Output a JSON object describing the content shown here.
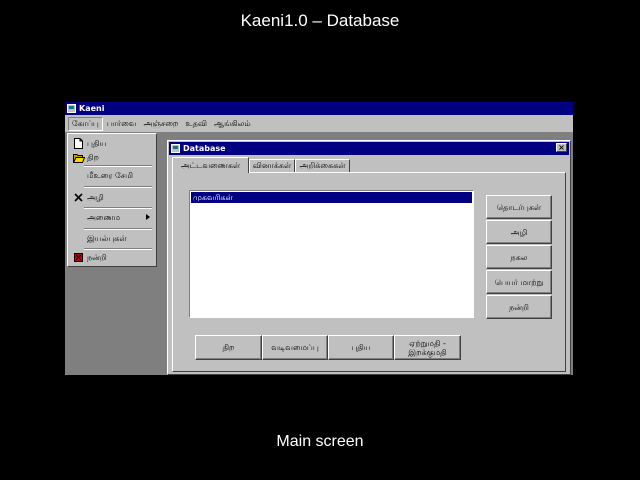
{
  "slide": {
    "title": "Kaeni1.0 – Database",
    "caption": "Main screen"
  },
  "app": {
    "title": "Kaeni",
    "menus": [
      "கோப்பு",
      "பார்வை",
      "அஞ்சறை",
      "உதவி",
      "ஆங்கிலம்"
    ],
    "file_menu": {
      "new": "புதிய",
      "open": "திற",
      "save_changes": "மீஉரை சேமி",
      "delete": "அழி",
      "page_setup": "அணைம",
      "properties": "இயல்புகள்",
      "exit": "நன்றி"
    }
  },
  "db_window": {
    "title": "Database",
    "close": "×",
    "tabs": [
      "அட்டவணைகள்",
      "வினாக்கள்",
      "அறிக்கைகள்"
    ],
    "list_items": [
      "முகவரிகள்"
    ],
    "side_buttons": [
      "தொடர்புகள்",
      "அழி",
      "நகல",
      "பெயர் மாற்று",
      "நன்றி"
    ],
    "bottom_buttons": {
      "open": "திற",
      "design": "வடிவமைப்பு",
      "new": "புதிய",
      "import_line1": "ஏற்றுமதி  -",
      "import_line2": "இறக்குமதி"
    }
  }
}
